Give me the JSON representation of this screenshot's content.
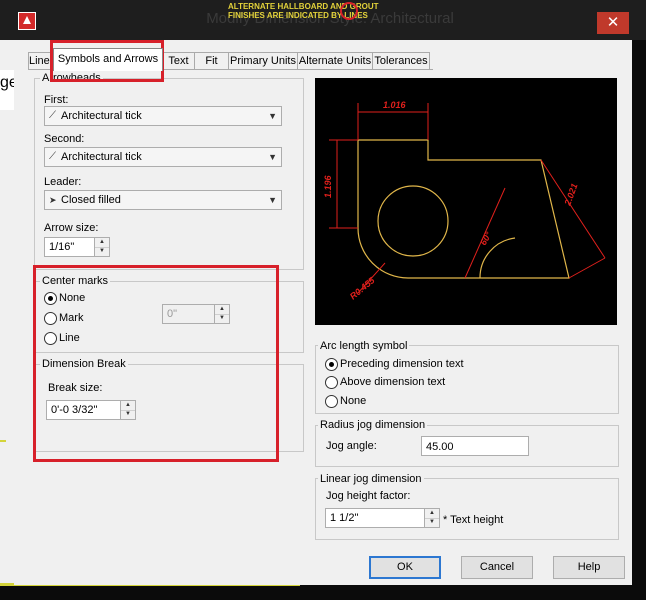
{
  "window": {
    "title": "Modify Dimension Style: Architectural",
    "close_glyph": "✕",
    "bg_cad_text_1": "ALTERNATE HALLBOARD AND GROUT",
    "bg_cad_text_2": "FINISHES ARE INDICATED BY LINES",
    "bg_left_text": "ge"
  },
  "tabs": [
    {
      "label": "Lines"
    },
    {
      "label": "Symbols and Arrows"
    },
    {
      "label": "Text"
    },
    {
      "label": "Fit"
    },
    {
      "label": "Primary Units"
    },
    {
      "label": "Alternate Units"
    },
    {
      "label": "Tolerances"
    }
  ],
  "arrowheads": {
    "legend": "Arrowheads",
    "first_label": "First:",
    "first_value": "Architectural tick",
    "second_label": "Second:",
    "second_value": "Architectural tick",
    "leader_label": "Leader:",
    "leader_value": "Closed filled",
    "arrow_size_label": "Arrow size:",
    "arrow_size_value": "1/16\""
  },
  "center_marks": {
    "legend": "Center marks",
    "options": [
      "None",
      "Mark",
      "Line"
    ],
    "selected": "None",
    "size_value": "0\""
  },
  "dimension_break": {
    "legend": "Dimension Break",
    "break_size_label": "Break size:",
    "break_size_value": "0'-0 3/32\""
  },
  "preview": {
    "dim_top": "1.016",
    "dim_left": "1.196",
    "dim_right": "2.021",
    "dim_angle": "60°",
    "dim_radius": "R0.455",
    "line_color": "#e0b64a",
    "dim_color": "#e0201c"
  },
  "arc_length_symbol": {
    "legend": "Arc length symbol",
    "options": [
      "Preceding dimension text",
      "Above dimension text",
      "None"
    ],
    "selected": "Preceding dimension text"
  },
  "radius_jog": {
    "legend": "Radius jog dimension",
    "jog_angle_label": "Jog angle:",
    "jog_angle_value": "45.00"
  },
  "linear_jog": {
    "legend": "Linear jog dimension",
    "jog_height_label": "Jog height factor:",
    "jog_height_value": "1 1/2\"",
    "jog_height_suffix": "* Text height"
  },
  "buttons": {
    "ok": "OK",
    "cancel": "Cancel",
    "help": "Help"
  },
  "annotation_color": "#d7202a"
}
